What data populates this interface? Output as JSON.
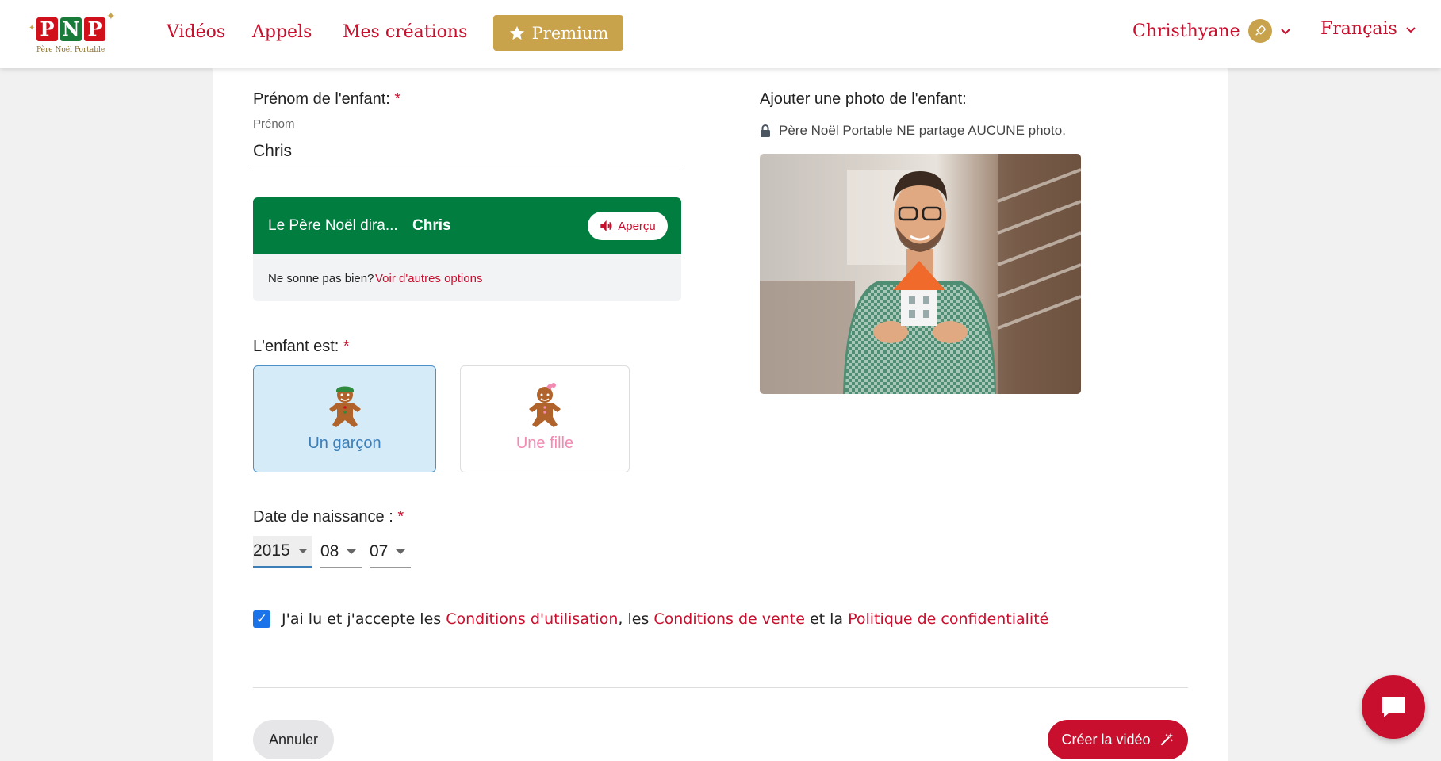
{
  "brand": {
    "logo_letters": [
      "P",
      "N",
      "P"
    ],
    "logo_subtitle": "Père Noël Portable",
    "colors": {
      "primary": "#c8102e",
      "gold": "#c9a24c",
      "green": "#017d40",
      "blue": "#3c7fb8",
      "pink": "#f28ab2"
    }
  },
  "nav": {
    "videos": "Vidéos",
    "calls": "Appels",
    "creations": "Mes créations",
    "premium": "Premium",
    "user_name": "Christhyane",
    "language": "Français"
  },
  "form": {
    "child_name_label": "Prénom de l'enfant:",
    "required_mark": "*",
    "first_name_small_label": "Prénom",
    "first_name_value": "Chris",
    "santa_says": "Le Père Noël dira...",
    "santa_name": "Chris",
    "preview_label": "Aperçu",
    "not_good_text": "Ne sonne pas bien?",
    "other_options_link": "Voir d'autres options",
    "child_is_label": "L'enfant est:",
    "boy_label": "Un garçon",
    "girl_label": "Une fille",
    "birth_date_label": "Date de naissance :",
    "birth_year": "2015",
    "birth_month": "08",
    "birth_day": "07",
    "terms_prefix": "J'ai lu et j'accepte les",
    "terms_link_1": "Conditions d'utilisation",
    "terms_sep_1": ", les",
    "terms_link_2": "Conditions de vente",
    "terms_sep_2": "et la",
    "terms_link_3": "Politique de confidentialité",
    "terms_checked": true,
    "cancel_label": "Annuler",
    "create_label": "Créer la vidéo"
  },
  "photo_section": {
    "label": "Ajouter une photo de l'enfant:",
    "privacy_text": "Père Noël Portable NE partage AUCUNE photo."
  },
  "icons": {
    "premium": "star-icon",
    "avatar": "rocket-icon",
    "preview": "speaker-icon",
    "privacy": "lock-icon",
    "create": "magic-wand-icon",
    "chat": "chat-icon"
  }
}
